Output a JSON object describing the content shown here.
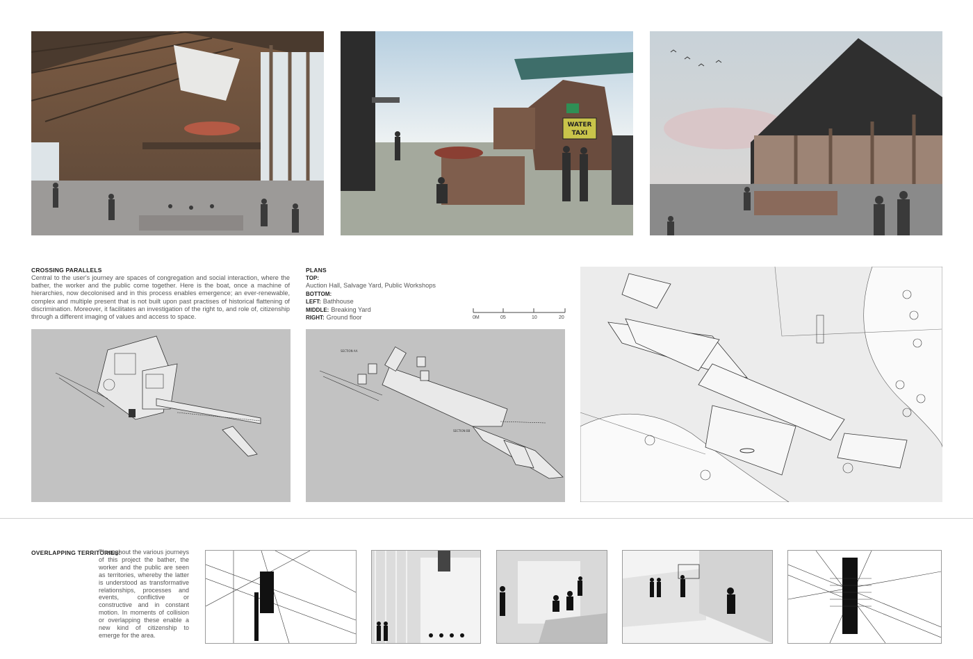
{
  "renders": [
    {
      "name": "auction-hall-render"
    },
    {
      "name": "salvage-yard-render",
      "sign_text": "WATER TAXI"
    },
    {
      "name": "public-workshops-render"
    }
  ],
  "crossing": {
    "title": "CROSSING PARALLELS",
    "body": "Central to the user's journey are spaces of congregation and social interaction, where the bather, the worker and the public come together. Here is the boat, once a machine of hierarchies, now decolonised and in this process enables emergence; an ever-renewable, complex and multiple present that is not built upon past practises of historical flattening of discrimination. Moreover, it facilitates an investigation of the right to, and role of, citizenship through a different imaging of values and access to space."
  },
  "plans": {
    "title": "PLANS",
    "top_label": "TOP:",
    "top_value": "Auction Hall, Salvage Yard, Public Workshops",
    "bottom_label": "BOTTOM:",
    "left_label": "LEFT:",
    "left_value": "Bathhouse",
    "middle_label": "MIDDLE:",
    "middle_value": "Breaking Yard",
    "right_label": "RIGHT:",
    "right_value": "Ground floor"
  },
  "scale": {
    "ticks": [
      "0M",
      "05",
      "10",
      "20"
    ]
  },
  "section_labels": [
    "SECTION AA",
    "SECTION BB"
  ],
  "overlapping": {
    "title": "OVERLAPPING TERRITORIES:",
    "body": "Throughout the various journeys of this project the bather, the worker and the public are seen as territories, whereby the latter is understood as transformative relationships, processes and events, conflictive or constructive and in constant motion. In moments of collision or overlapping these enable a new kind of citizenship to emerge for the area."
  },
  "colors": {
    "panel_gray": "#c2c2c2",
    "line": "#333333",
    "divider": "#cfcfcf"
  }
}
